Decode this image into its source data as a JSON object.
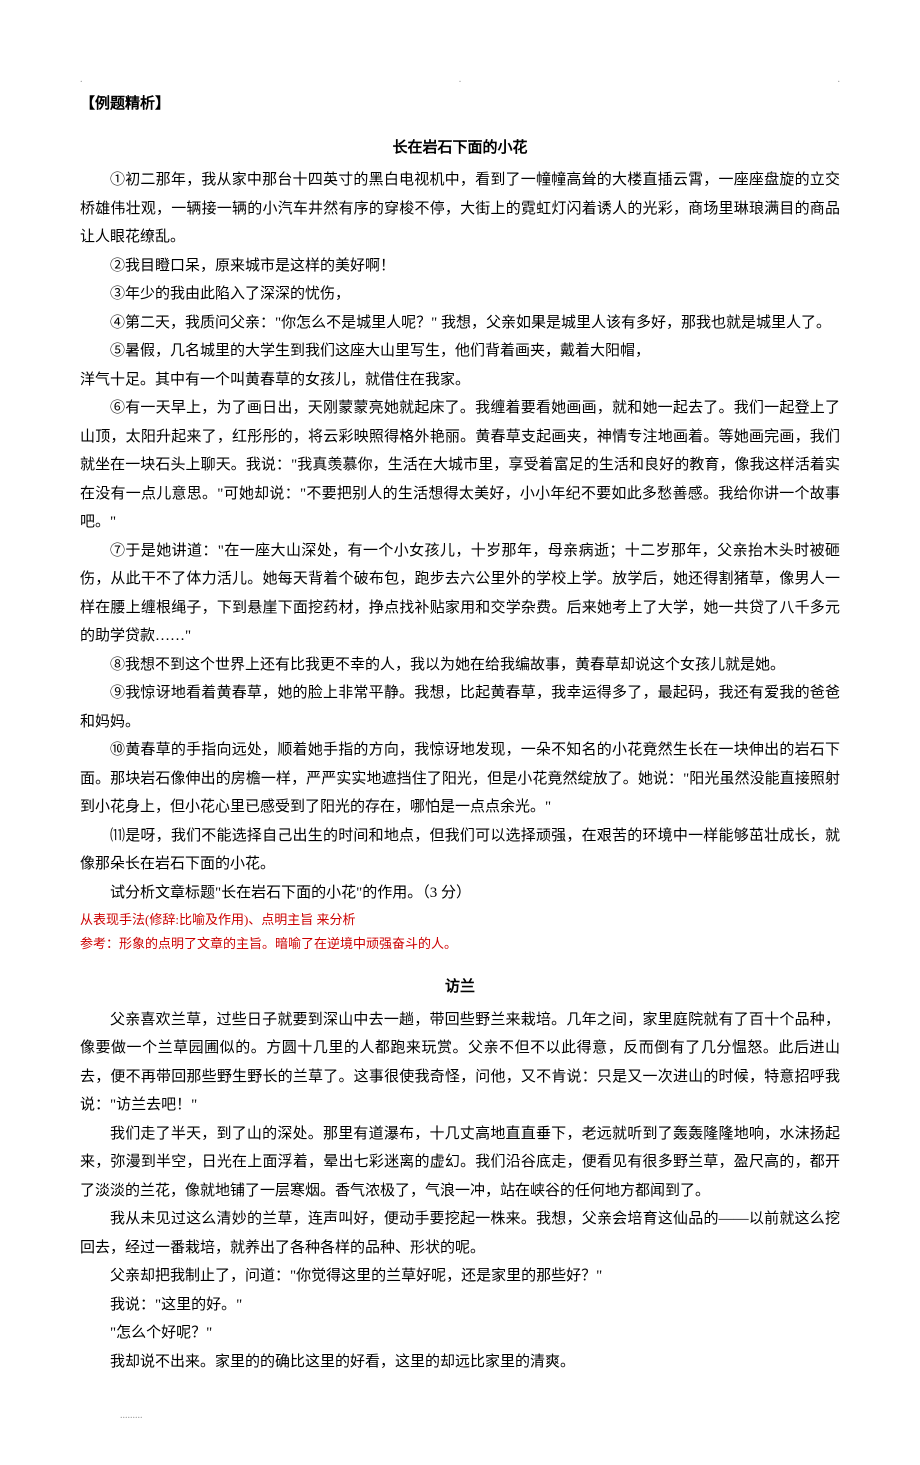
{
  "header": {
    "dot1": ".",
    "dot2": ".",
    "dot3": "."
  },
  "section_label": "【例题精析】",
  "article1": {
    "title": "长在岩石下面的小花",
    "paragraphs": [
      "①初二那年，我从家中那台十四英寸的黑白电视机中，看到了一幢幢高耸的大楼直插云霄，一座座盘旋的立交桥雄伟壮观，一辆接一辆的小汽车井然有序的穿梭不停，大街上的霓虹灯闪着诱人的光彩，商场里琳琅满目的商品让人眼花缭乱。",
      "②我目瞪口呆，原来城市是这样的美好啊！",
      "③年少的我由此陷入了深深的忧伤，",
      "④第二天，我质问父亲：\"你怎么不是城里人呢？\" 我想，父亲如果是城里人该有多好，那我也就是城里人了。",
      "⑤暑假，几名城里的大学生到我们这座大山里写生，他们背着画夹，戴着大阳帽，",
      "洋气十足。其中有一个叫黄春草的女孩儿，就借住在我家。",
      "⑥有一天早上，为了画日出，天刚蒙蒙亮她就起床了。我缠着要看她画画，就和她一起去了。我们一起登上了山顶，太阳升起来了，红彤彤的，将云彩映照得格外艳丽。黄春草支起画夹，神情专注地画着。等她画完画，我们就坐在一块石头上聊天。我说：\"我真羡慕你，生活在大城市里，享受着富足的生活和良好的教育，像我这样活着实在没有一点儿意思。\"可她却说：\"不要把别人的生活想得太美好，小小年纪不要如此多愁善感。我给你讲一个故事吧。\"",
      "⑦于是她讲道：\"在一座大山深处，有一个小女孩儿，十岁那年，母亲病逝；十二岁那年，父亲抬木头时被砸伤，从此干不了体力活儿。她每天背着个破布包，跑步去六公里外的学校上学。放学后，她还得割猪草，像男人一样在腰上缠根绳子，下到悬崖下面挖药材，挣点找补贴家用和交学杂费。后来她考上了大学，她一共贷了八千多元的助学贷款……\"",
      "⑧我想不到这个世界上还有比我更不幸的人，我以为她在给我编故事，黄春草却说这个女孩儿就是她。",
      "⑨我惊讶地看着黄春草，她的脸上非常平静。我想，比起黄春草，我幸运得多了，最起码，我还有爱我的爸爸和妈妈。",
      "⑩黄春草的手指向远处，顺着她手指的方向，我惊讶地发现，一朵不知名的小花竟然生长在一块伸出的岩石下面。那块岩石像伸出的房檐一样，严严实实地遮挡住了阳光，但是小花竟然绽放了。她说：\"阳光虽然没能直接照射到小花身上，但小花心里已感受到了阳光的存在，哪怕是一点点余光。\"",
      "⑾是呀，我们不能选择自己出生的时间和地点，但我们可以选择顽强，在艰苦的环境中一样能够茁壮成长，就像那朵长在岩石下面的小花。"
    ],
    "question": "试分析文章标题\"长在岩石下面的小花\"的作用。（3 分）",
    "hint1": "从表现手法(修辞:比喻及作用)、点明主旨 来分析",
    "hint2": "参考：形象的点明了文章的主旨。暗喻了在逆境中顽强奋斗的人。"
  },
  "article2": {
    "title": "访兰",
    "paragraphs": [
      "父亲喜欢兰草，过些日子就要到深山中去一趟，带回些野兰来栽培。几年之间，家里庭院就有了百十个品种，像要做一个兰草园圃似的。方圆十几里的人都跑来玩赏。父亲不但不以此得意，反而倒有了几分愠怒。此后进山去，便不再带回那些野生野长的兰草了。这事很使我奇怪，问他，又不肯说：只是又一次进山的时候，特意招呼我说：\"访兰去吧！\"",
      "我们走了半天，到了山的深处。那里有道瀑布，十几丈高地直直垂下，老远就听到了轰轰隆隆地响，水沫扬起来，弥漫到半空，日光在上面浮着，晕出七彩迷离的虚幻。我们沿谷底走，便看见有很多野兰草，盈尺高的，都开了淡淡的兰花，像就地铺了一层寒烟。香气浓极了，气浪一冲，站在峡谷的任何地方都闻到了。",
      "我从未见过这么清妙的兰草，连声叫好，便动手要挖起一株来。我想，父亲会培育这仙品的——以前就这么挖回去，经过一番栽培，就养出了各种各样的品种、形状的呢。",
      "父亲却把我制止了，问道：\"你觉得这里的兰草好呢，还是家里的那些好？\"",
      "我说：\"这里的好。\"",
      "\"怎么个好呢？\"",
      "我却说不出来。家里的的确比这里的好看，这里的却远比家里的清爽。"
    ]
  },
  "footer": "........."
}
